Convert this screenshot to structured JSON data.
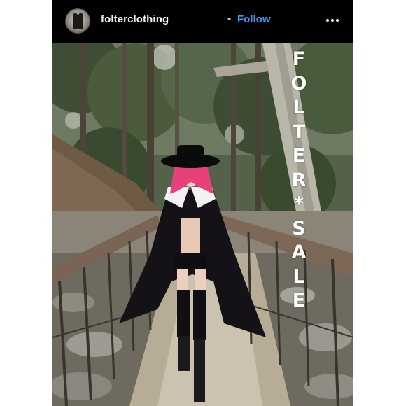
{
  "post": {
    "header": {
      "username": "folterclothing",
      "separator": "•",
      "follow_label": "Follow",
      "avatar_icon": "avatar-photo-icon",
      "more_icon": "more-options-icon"
    },
    "photo": {
      "overlay_letters": [
        "F",
        "O",
        "L",
        "T",
        "E",
        "R",
        "*",
        "S",
        "A",
        "L",
        "E"
      ]
    }
  },
  "colors": {
    "header_bg": "#000000",
    "follow": "#3897f0",
    "username": "#f4f4f4",
    "overlay_text": "#ffffff"
  }
}
